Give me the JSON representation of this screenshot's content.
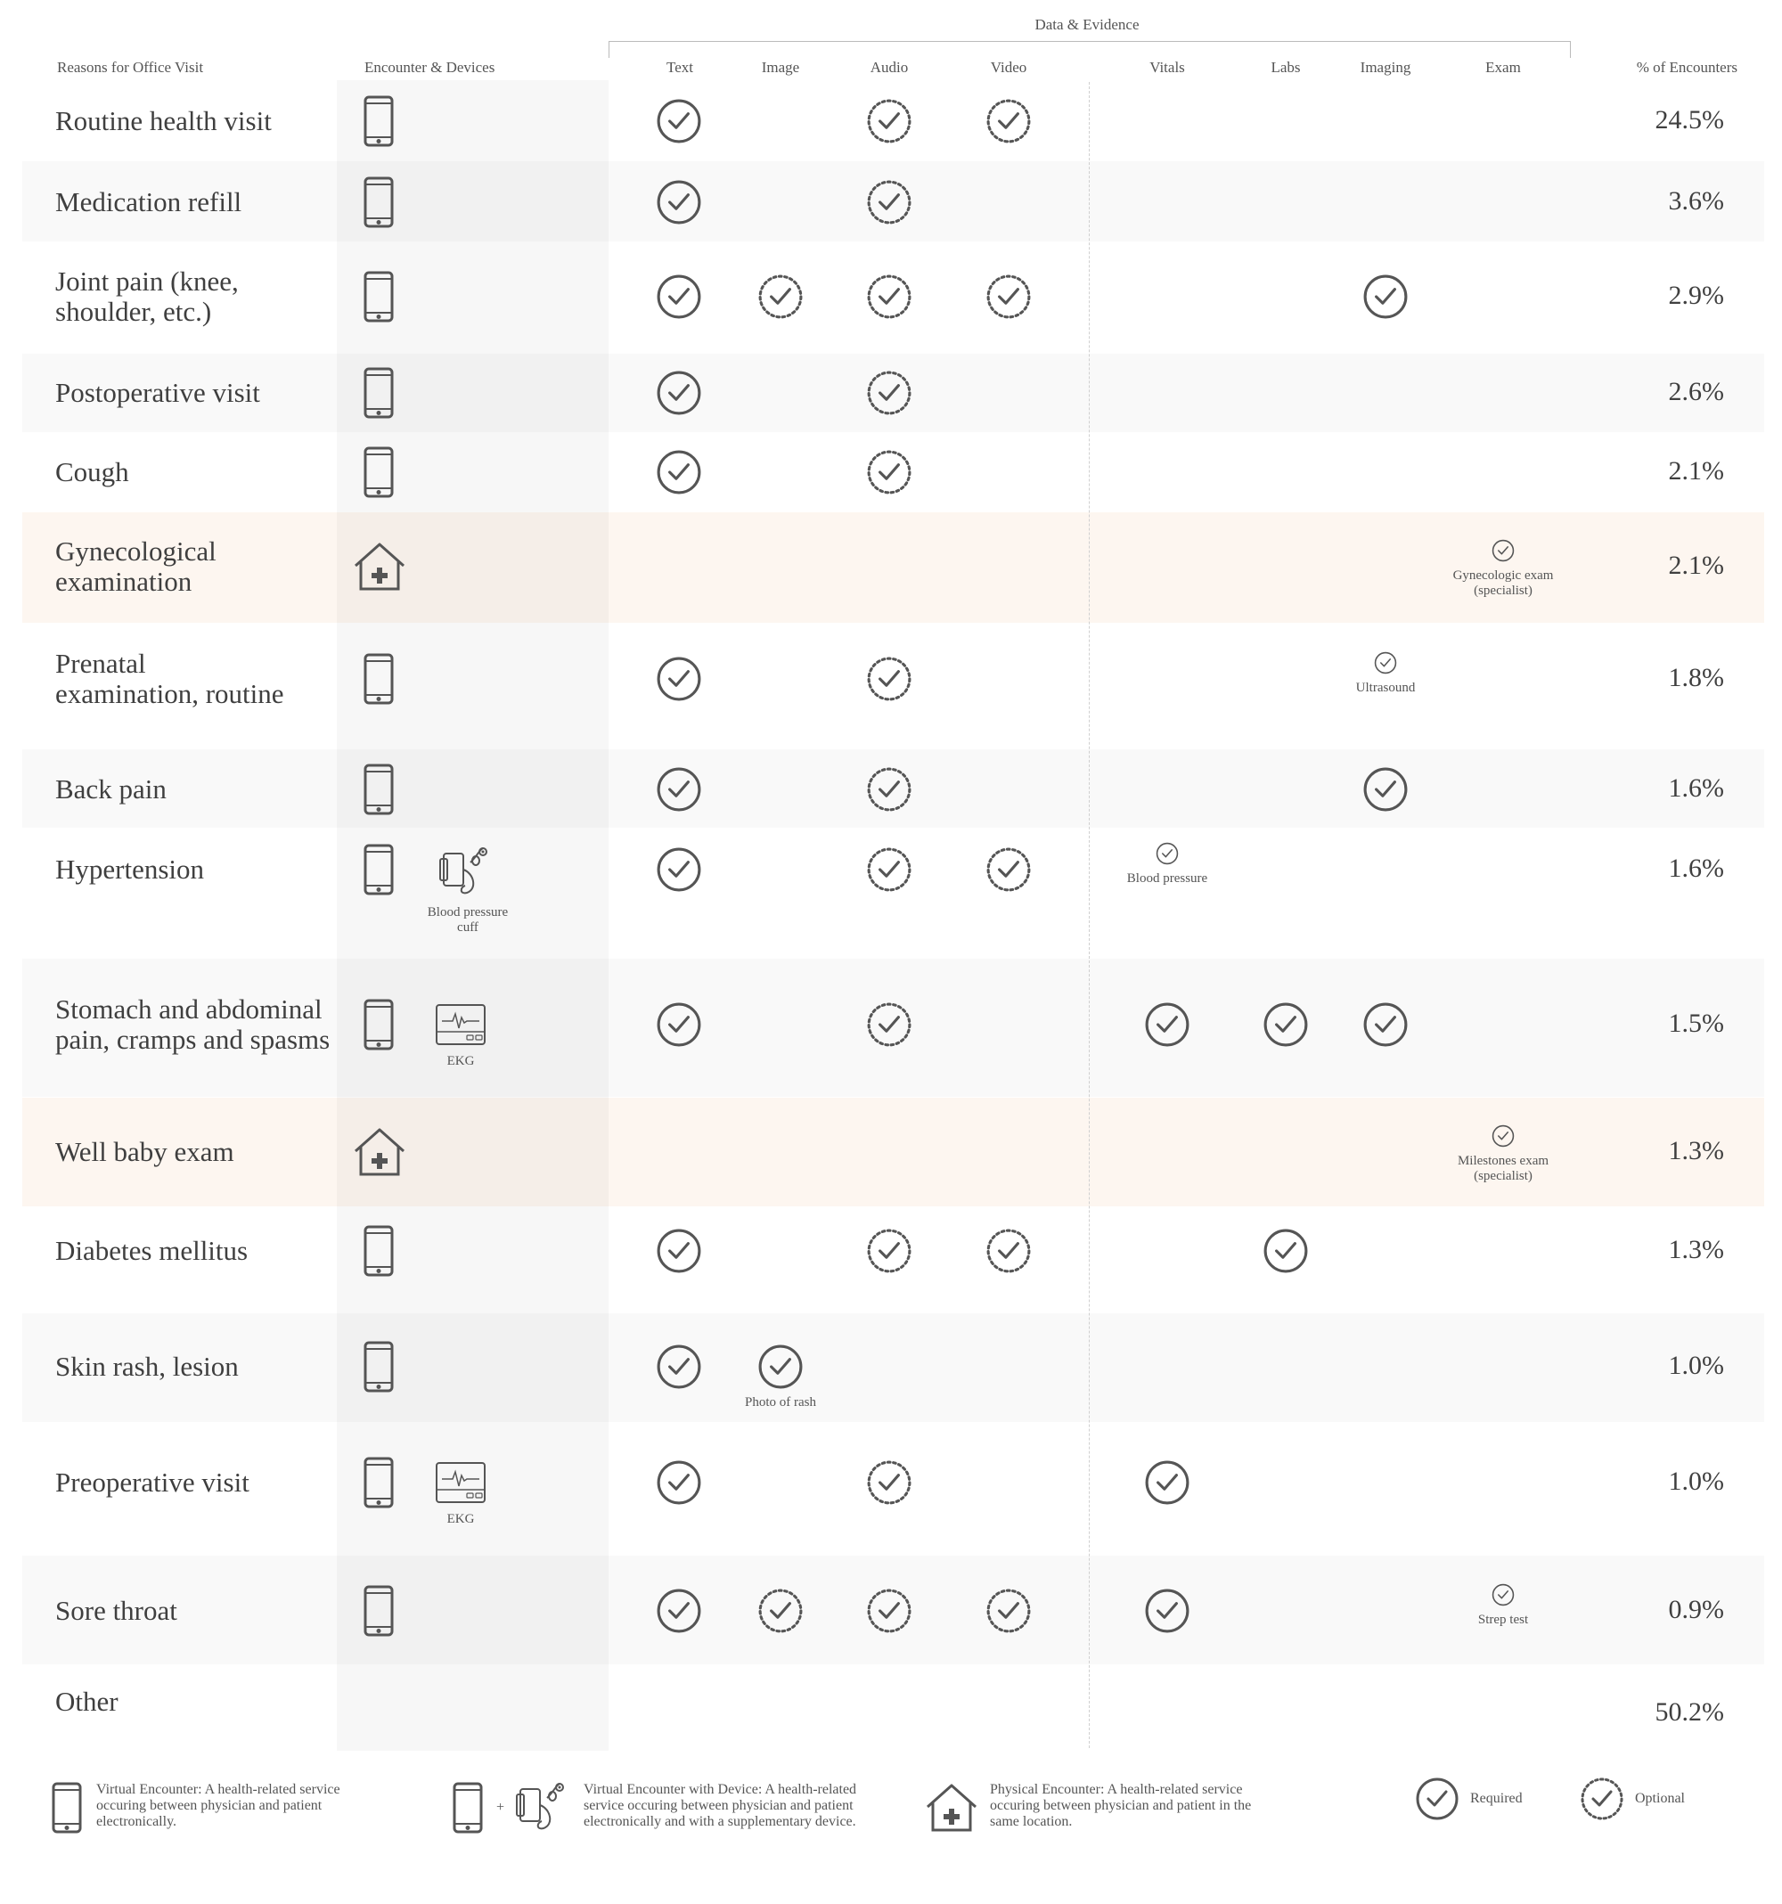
{
  "header": {
    "group_title": "Data & Evidence",
    "columns": {
      "reason": "Reasons for Office Visit",
      "encounter": "Encounter & Devices",
      "text": "Text",
      "image": "Image",
      "audio": "Audio",
      "video": "Video",
      "vitals": "Vitals",
      "labs": "Labs",
      "imaging": "Imaging",
      "exam": "Exam",
      "pct": "% of Encounters"
    }
  },
  "rows": [
    {
      "reason": [
        "Routine health visit"
      ],
      "encounter": "virtual",
      "text": "required",
      "audio": "optional",
      "video": "optional",
      "pct": "24.5%"
    },
    {
      "reason": [
        "Medication refill"
      ],
      "encounter": "virtual",
      "text": "required",
      "audio": "optional",
      "pct": "3.6%"
    },
    {
      "reason": [
        "Joint pain (knee,",
        "shoulder, etc.)"
      ],
      "encounter": "virtual",
      "text": "required",
      "image": "optional",
      "audio": "optional",
      "video": "optional",
      "imaging": "required",
      "pct": "2.9%"
    },
    {
      "reason": [
        "Postoperative visit"
      ],
      "encounter": "virtual",
      "text": "required",
      "audio": "optional",
      "pct": "2.6%"
    },
    {
      "reason": [
        "Cough"
      ],
      "encounter": "virtual",
      "text": "required",
      "audio": "optional",
      "pct": "2.1%"
    },
    {
      "reason": [
        "Gynecological",
        "examination"
      ],
      "encounter": "physical",
      "exam": "required",
      "exam_label": [
        "Gynecologic exam",
        "(specialist)"
      ],
      "pct": "2.1%"
    },
    {
      "reason": [
        "Prenatal",
        "examination, routine"
      ],
      "encounter": "virtual",
      "text": "required",
      "audio": "optional",
      "imaging": "required",
      "imaging_label": [
        "Ultrasound"
      ],
      "pct": "1.8%"
    },
    {
      "reason": [
        "Back pain"
      ],
      "encounter": "virtual",
      "text": "required",
      "audio": "optional",
      "imaging": "required",
      "pct": "1.6%"
    },
    {
      "reason": [
        "Hypertension"
      ],
      "encounter": "virtual",
      "device": "bp-cuff",
      "device_label": [
        "Blood pressure",
        "cuff"
      ],
      "text": "required",
      "audio": "optional",
      "video": "optional",
      "vitals": "required",
      "vitals_label": [
        "Blood pressure"
      ],
      "pct": "1.6%"
    },
    {
      "reason": [
        "Stomach and abdominal",
        "pain, cramps and spasms"
      ],
      "encounter": "virtual",
      "device": "ekg",
      "device_label": [
        "EKG"
      ],
      "text": "required",
      "audio": "optional",
      "vitals": "required",
      "labs": "required",
      "imaging": "required",
      "pct": "1.5%"
    },
    {
      "reason": [
        "Well baby exam"
      ],
      "encounter": "physical",
      "exam": "required",
      "exam_label": [
        "Milestones exam",
        "(specialist)"
      ],
      "pct": "1.3%"
    },
    {
      "reason": [
        "Diabetes mellitus"
      ],
      "encounter": "virtual",
      "text": "required",
      "audio": "optional",
      "video": "optional",
      "labs": "required",
      "pct": "1.3%"
    },
    {
      "reason": [
        "Skin rash, lesion"
      ],
      "encounter": "virtual",
      "text": "required",
      "image": "required",
      "image_label": [
        "Photo of rash"
      ],
      "pct": "1.0%"
    },
    {
      "reason": [
        "Preoperative visit"
      ],
      "encounter": "virtual",
      "device": "ekg",
      "device_label": [
        "EKG"
      ],
      "text": "required",
      "audio": "optional",
      "vitals": "required",
      "pct": "1.0%"
    },
    {
      "reason": [
        "Sore throat"
      ],
      "encounter": "virtual",
      "text": "required",
      "image": "optional",
      "audio": "optional",
      "video": "optional",
      "vitals": "required",
      "exam": "required",
      "exam_label": [
        "Strep test"
      ],
      "pct": "0.9%"
    },
    {
      "reason": [
        "Other"
      ],
      "pct": "50.2%"
    }
  ],
  "legend": {
    "virtual": "Virtual Encounter: A health-related service occuring between physician and patient electronically.",
    "plus": "+",
    "virtual_device": "Virtual Encounter with Device: A health-related service occuring between physician and patient electronically and with a supplementary device.",
    "physical": "Physical Encounter: A health-related service occuring between physician and patient in the same location.",
    "required": "Required",
    "optional": "Optional"
  },
  "colors": {
    "ink": "#4a4a4a",
    "alt_row": "#f9f9f9",
    "physical_row": "#fdf6f0",
    "device_column": "#f3f3f3"
  },
  "icons": [
    "phone-icon",
    "clinic-house-icon",
    "bp-cuff-icon",
    "ekg-icon",
    "required-check-icon",
    "optional-check-icon"
  ]
}
